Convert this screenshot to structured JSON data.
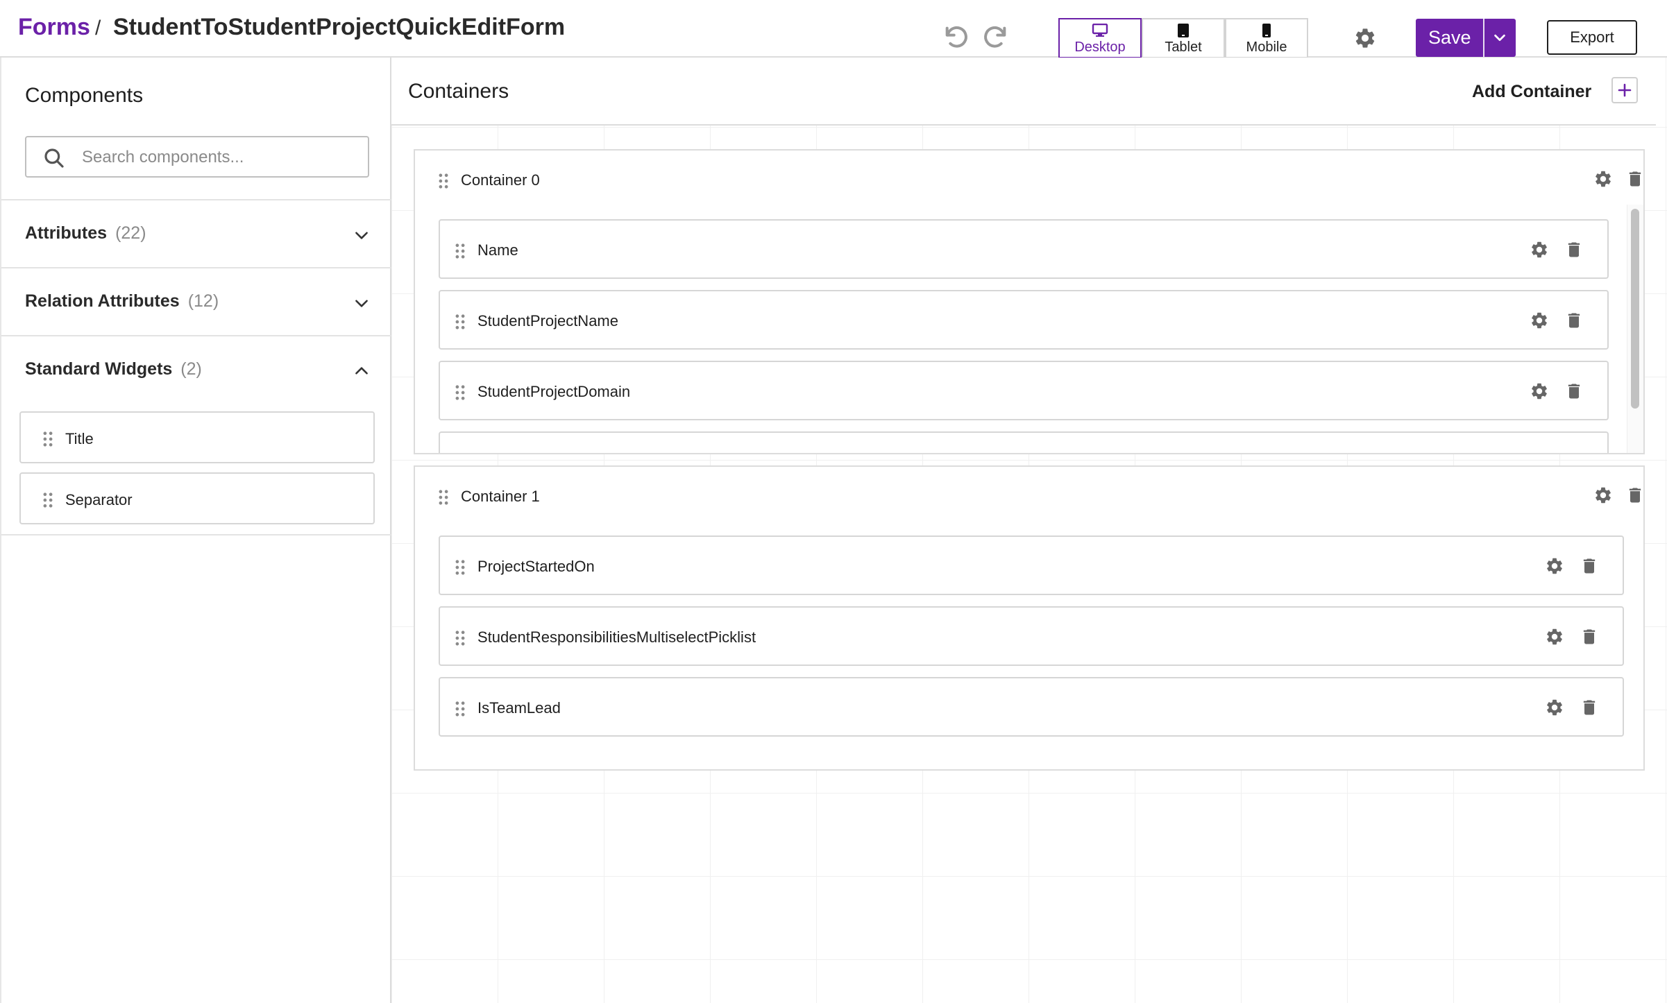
{
  "header": {
    "breadcrumb_link": "Forms",
    "breadcrumb_sep": "/",
    "form_name": "StudentToStudentProjectQuickEditForm",
    "view_tabs": [
      {
        "label": "Desktop",
        "icon": "desktop-icon",
        "active": true
      },
      {
        "label": "Tablet",
        "icon": "tablet-icon",
        "active": false
      },
      {
        "label": "Mobile",
        "icon": "mobile-icon",
        "active": false
      }
    ],
    "save_label": "Save",
    "export_label": "Export"
  },
  "sidebar": {
    "title": "Components",
    "search_placeholder": "Search components...",
    "sections": [
      {
        "label": "Attributes",
        "count": "(22)",
        "expanded": false
      },
      {
        "label": "Relation Attributes",
        "count": "(12)",
        "expanded": false
      },
      {
        "label": "Standard Widgets",
        "count": "(2)",
        "expanded": true
      }
    ],
    "widgets": [
      "Title",
      "Separator"
    ]
  },
  "main": {
    "title": "Containers",
    "add_container_label": "Add Container",
    "containers": [
      {
        "name": "Container 0",
        "fields": [
          "Name",
          "StudentProjectName",
          "StudentProjectDomain",
          ""
        ]
      },
      {
        "name": "Container 1",
        "fields": [
          "ProjectStartedOn",
          "StudentResponsibilitiesMultiselectPicklist",
          "IsTeamLead"
        ]
      }
    ]
  },
  "colors": {
    "accent": "#6b21a8",
    "border": "#d6d6d6",
    "icon_gray": "#666666"
  }
}
